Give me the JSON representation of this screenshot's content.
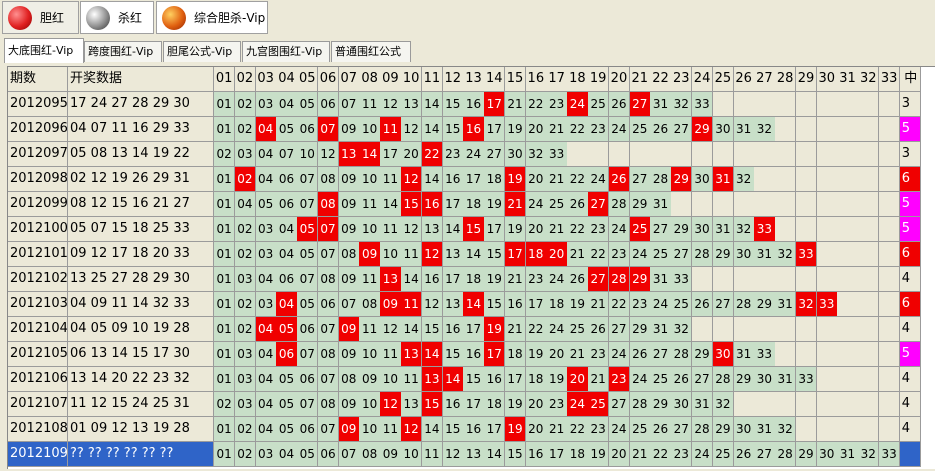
{
  "top_tabs": [
    {
      "label": "胆红",
      "icon": "red-ball-icon",
      "color": "#e02020",
      "active": true
    },
    {
      "label": "杀红",
      "icon": "gray-ball-icon",
      "color": "#606060",
      "active": false
    },
    {
      "label": "综合胆杀-Vip",
      "icon": "orange-ball-icon",
      "color": "#e06010",
      "active": false
    }
  ],
  "sub_tabs": [
    {
      "label": "大底围红-Vip",
      "active": true
    },
    {
      "label": "跨度围红-Vip",
      "active": false
    },
    {
      "label": "胆尾公式-Vip",
      "active": false
    },
    {
      "label": "九宫图围红-Vip",
      "active": false
    },
    {
      "label": "普通围红公式",
      "active": false
    }
  ],
  "table": {
    "col_period": "期数",
    "col_draw": "开奖数据",
    "col_count": "中",
    "numbers": [
      "01",
      "02",
      "03",
      "04",
      "05",
      "06",
      "07",
      "08",
      "09",
      "10",
      "11",
      "12",
      "13",
      "14",
      "15",
      "16",
      "17",
      "18",
      "19",
      "20",
      "21",
      "22",
      "23",
      "24",
      "25",
      "26",
      "27",
      "28",
      "29",
      "30",
      "31",
      "32",
      "33"
    ],
    "rows": [
      {
        "period": "2012095",
        "draw": "17 24 27 28 29 30",
        "cells": [
          "01",
          "02",
          "03",
          "04",
          "05",
          "06",
          "07",
          "11",
          "12",
          "13",
          "14",
          "15",
          "16",
          "17",
          "21",
          "22",
          "23",
          "24",
          "25",
          "26",
          "27",
          "31",
          "32",
          "33"
        ],
        "hits": [
          "17",
          "24",
          "27"
        ],
        "count": "3",
        "count_style": "plain"
      },
      {
        "period": "2012096",
        "draw": "04 07 11 16 29 33",
        "cells": [
          "01",
          "02",
          "04",
          "05",
          "06",
          "07",
          "09",
          "10",
          "11",
          "12",
          "14",
          "15",
          "16",
          "17",
          "19",
          "20",
          "21",
          "22",
          "23",
          "24",
          "25",
          "26",
          "27",
          "29",
          "30",
          "31",
          "32"
        ],
        "hits": [
          "04",
          "07",
          "11",
          "16",
          "29"
        ],
        "count": "5",
        "count_style": "magenta"
      },
      {
        "period": "2012097",
        "draw": "05 08 13 14 19 22",
        "cells": [
          "02",
          "03",
          "04",
          "07",
          "10",
          "12",
          "13",
          "14",
          "17",
          "20",
          "22",
          "23",
          "24",
          "27",
          "30",
          "32",
          "33"
        ],
        "hits": [
          "13",
          "14",
          "22"
        ],
        "count": "3",
        "count_style": "plain"
      },
      {
        "period": "2012098",
        "draw": "02 12 19 26 29 31",
        "cells": [
          "01",
          "02",
          "04",
          "06",
          "07",
          "08",
          "09",
          "10",
          "11",
          "12",
          "14",
          "16",
          "17",
          "18",
          "19",
          "20",
          "21",
          "22",
          "24",
          "26",
          "27",
          "28",
          "29",
          "30",
          "31",
          "32"
        ],
        "hits": [
          "02",
          "12",
          "19",
          "26",
          "29",
          "31"
        ],
        "count": "6",
        "count_style": "red"
      },
      {
        "period": "2012099",
        "draw": "08 12 15 16 21 27",
        "cells": [
          "01",
          "04",
          "05",
          "06",
          "07",
          "08",
          "09",
          "11",
          "14",
          "15",
          "16",
          "17",
          "18",
          "19",
          "21",
          "24",
          "25",
          "26",
          "27",
          "28",
          "29",
          "31"
        ],
        "hits": [
          "08",
          "15",
          "16",
          "21",
          "27"
        ],
        "count": "5",
        "count_style": "magenta"
      },
      {
        "period": "2012100",
        "draw": "05 07 15 18 25 33",
        "cells": [
          "01",
          "02",
          "03",
          "04",
          "05",
          "07",
          "09",
          "10",
          "11",
          "12",
          "13",
          "14",
          "15",
          "17",
          "19",
          "20",
          "21",
          "22",
          "23",
          "24",
          "25",
          "27",
          "29",
          "30",
          "31",
          "32",
          "33"
        ],
        "hits": [
          "05",
          "07",
          "15",
          "25",
          "33"
        ],
        "count": "5",
        "count_style": "magenta"
      },
      {
        "period": "2012101",
        "draw": "09 12 17 18 20 33",
        "cells": [
          "01",
          "02",
          "03",
          "04",
          "05",
          "07",
          "08",
          "09",
          "10",
          "11",
          "12",
          "13",
          "14",
          "15",
          "17",
          "18",
          "20",
          "21",
          "22",
          "23",
          "24",
          "25",
          "27",
          "28",
          "29",
          "30",
          "31",
          "32",
          "33"
        ],
        "hits": [
          "09",
          "12",
          "17",
          "18",
          "20",
          "33"
        ],
        "count": "6",
        "count_style": "red"
      },
      {
        "period": "2012102",
        "draw": "13 25 27 28 29 30",
        "cells": [
          "01",
          "03",
          "04",
          "06",
          "07",
          "08",
          "09",
          "11",
          "13",
          "14",
          "16",
          "17",
          "18",
          "19",
          "21",
          "23",
          "24",
          "26",
          "27",
          "28",
          "29",
          "31",
          "33"
        ],
        "hits": [
          "13",
          "27",
          "28",
          "29"
        ],
        "count": "4",
        "count_style": "plain"
      },
      {
        "period": "2012103",
        "draw": "04 09 11 14 32 33",
        "cells": [
          "01",
          "02",
          "03",
          "04",
          "05",
          "06",
          "07",
          "08",
          "09",
          "11",
          "12",
          "13",
          "14",
          "15",
          "16",
          "17",
          "18",
          "19",
          "21",
          "22",
          "23",
          "24",
          "25",
          "26",
          "27",
          "28",
          "29",
          "31",
          "32",
          "33"
        ],
        "hits": [
          "04",
          "09",
          "11",
          "14",
          "32",
          "33"
        ],
        "count": "6",
        "count_style": "red"
      },
      {
        "period": "2012104",
        "draw": "04 05 09 10 19 28",
        "cells": [
          "01",
          "02",
          "04",
          "05",
          "06",
          "07",
          "09",
          "11",
          "12",
          "14",
          "15",
          "16",
          "17",
          "19",
          "21",
          "22",
          "24",
          "25",
          "26",
          "27",
          "29",
          "31",
          "32"
        ],
        "hits": [
          "04",
          "05",
          "09",
          "19"
        ],
        "count": "4",
        "count_style": "plain"
      },
      {
        "period": "2012105",
        "draw": "06 13 14 15 17 30",
        "cells": [
          "01",
          "03",
          "04",
          "06",
          "07",
          "08",
          "09",
          "10",
          "11",
          "13",
          "14",
          "15",
          "16",
          "17",
          "18",
          "19",
          "20",
          "21",
          "23",
          "24",
          "26",
          "27",
          "28",
          "29",
          "30",
          "31",
          "33"
        ],
        "hits": [
          "06",
          "13",
          "14",
          "17",
          "30"
        ],
        "count": "5",
        "count_style": "magenta"
      },
      {
        "period": "2012106",
        "draw": "13 14 20 22 23 32",
        "cells": [
          "01",
          "03",
          "04",
          "05",
          "06",
          "07",
          "08",
          "09",
          "10",
          "11",
          "13",
          "14",
          "15",
          "16",
          "17",
          "18",
          "19",
          "20",
          "21",
          "23",
          "24",
          "25",
          "26",
          "27",
          "28",
          "29",
          "30",
          "31",
          "33"
        ],
        "hits": [
          "13",
          "14",
          "20",
          "23"
        ],
        "count": "4",
        "count_style": "plain"
      },
      {
        "period": "2012107",
        "draw": "11 12 15 24 25 31",
        "cells": [
          "02",
          "03",
          "04",
          "05",
          "07",
          "08",
          "09",
          "10",
          "12",
          "13",
          "15",
          "16",
          "17",
          "18",
          "19",
          "20",
          "23",
          "24",
          "25",
          "27",
          "28",
          "29",
          "30",
          "31",
          "32"
        ],
        "hits": [
          "12",
          "15",
          "24",
          "25"
        ],
        "count": "4",
        "count_style": "plain"
      },
      {
        "period": "2012108",
        "draw": "01 09 12 13 19 28",
        "cells": [
          "01",
          "02",
          "04",
          "05",
          "06",
          "07",
          "09",
          "10",
          "11",
          "12",
          "14",
          "15",
          "16",
          "17",
          "19",
          "20",
          "21",
          "22",
          "23",
          "24",
          "25",
          "26",
          "27",
          "28",
          "29",
          "30",
          "31",
          "32"
        ],
        "hits": [
          "09",
          "12",
          "19"
        ],
        "count": "4",
        "count_style": "plain"
      },
      {
        "period": "2012109",
        "draw": "?? ?? ?? ?? ?? ??",
        "cells": [
          "01",
          "02",
          "03",
          "04",
          "05",
          "06",
          "07",
          "08",
          "09",
          "10",
          "11",
          "12",
          "13",
          "14",
          "15",
          "16",
          "17",
          "18",
          "19",
          "20",
          "21",
          "22",
          "23",
          "24",
          "25",
          "26",
          "27",
          "28",
          "29",
          "30",
          "31",
          "32",
          "33"
        ],
        "hits": [],
        "count": "",
        "count_style": "blue"
      }
    ]
  }
}
